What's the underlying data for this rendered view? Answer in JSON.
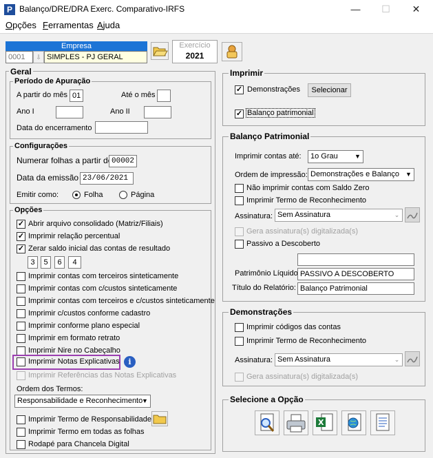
{
  "window": {
    "title": "Balanço/DRE/DRA Exerc. Comparativo-IRFS",
    "app_icon": "P",
    "minimize": "—",
    "maximize": "☐",
    "close": "✕"
  },
  "menu": {
    "opcoes": {
      "u": "O",
      "rest": "pções"
    },
    "ferramentas": {
      "u": "F",
      "rest": "erramentas"
    },
    "ajuda": {
      "u": "A",
      "rest": "juda"
    }
  },
  "empresa": {
    "label": "Empresa",
    "code": "0001",
    "name": "SIMPLES - PJ GERAL"
  },
  "exercicio": {
    "label": "Exercício",
    "value": "2021"
  },
  "geral": {
    "title": "Geral",
    "periodo": {
      "title": "Período de Apuração",
      "a_partir_label": "A partir do mês",
      "a_partir_value": "01",
      "ate_label": "Até o mês",
      "ate_value": "",
      "ano1_label": "Ano I",
      "ano1_value": "",
      "ano2_label": "Ano II",
      "ano2_value": "",
      "encerramento_label": "Data do encerramento",
      "encerramento_value": ""
    },
    "config": {
      "title": "Configurações",
      "numerar_label": "Numerar folhas a partir de",
      "numerar_value": "00002",
      "emissao_label": "Data da emissão",
      "emissao_value": "23/06/2021",
      "emitir_label": "Emitir como:",
      "folha": "Folha",
      "pagina": "Página"
    },
    "opcoes": {
      "title": "Opções",
      "items": [
        {
          "label": "Abrir arquivo consolidado (Matriz/Filiais)",
          "checked": true
        },
        {
          "label": "Imprimir relação percentual",
          "checked": true
        },
        {
          "label": "Zerar saldo inicial das contas de resultado",
          "checked": true
        }
      ],
      "digits": [
        "3",
        "5",
        "6",
        "4"
      ],
      "items2": [
        "Imprimir contas com terceiros sinteticamente",
        "Imprimir contas com c/custos sinteticamente",
        "Imprimir contas com terceiros e c/custos sinteticamente",
        "Imprimir c/custos conforme cadastro",
        "Imprimir conforme plano especial",
        "Imprimir em formato retrato",
        "Imprimir Nire no Cabeçalho",
        "Imprimir Notas Explicativas"
      ],
      "referencias": "Imprimir Referências das Notas Explicativas",
      "ordem_label": "Ordem dos Termos:",
      "ordem_value": "Responsabilidade e Reconhecimento",
      "termo_resp": "Imprimir Termo de Responsabilidade",
      "termo_todas": "Imprimir Termo em todas as folhas",
      "rodape": "Rodapé para Chancela Digital"
    }
  },
  "imprimir": {
    "title": "Imprimir",
    "demonstracoes": "Demonstrações",
    "selecionar": "Selecionar",
    "balanco": "Balanço patrimonial"
  },
  "balanco": {
    "title": "Balanço Patrimonial",
    "contas_label": "Imprimir contas até:",
    "contas_value": "1o Grau",
    "ordem_label": "Ordem de impressão:",
    "ordem_value": "Demonstrações e Balanço",
    "nao_saldo_zero": "Não imprimir contas com Saldo Zero",
    "termo_reconh": "Imprimir Termo de Reconhecimento",
    "assinatura_label": "Assinatura:",
    "assinatura_value": "Sem Assinatura",
    "gera_assinatura": "Gera assinatura(s) digitalizada(s)",
    "passivo": "Passivo a Descoberto",
    "passivo_value": "",
    "pl_label": "Patrimônio Líquido:",
    "pl_value": "PASSIVO A DESCOBERTO",
    "titulo_label": "Título do Relatório:",
    "titulo_value": "Balanço Patrimonial"
  },
  "demonstracoes": {
    "title": "Demonstrações",
    "codigos": "Imprimir códigos das contas",
    "termo_reconh": "Imprimir Termo de Reconhecimento",
    "assinatura_label": "Assinatura:",
    "assinatura_value": "Sem Assinatura",
    "gera_assinatura": "Gera assinatura(s) digitalizada(s)"
  },
  "selecione": {
    "title": "Selecione a Opção"
  },
  "colors": {
    "empresa_header": "#1c74d6",
    "highlight_border": "#9b3fb0",
    "field_yellow": "#ffffe1"
  }
}
